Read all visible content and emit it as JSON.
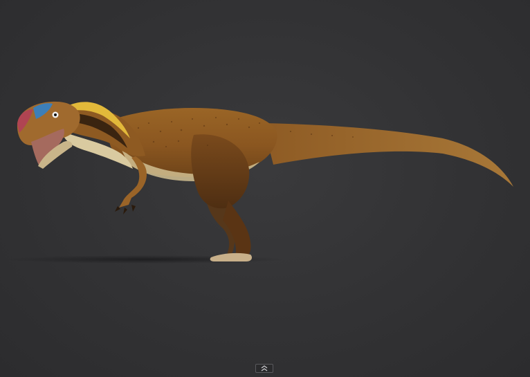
{
  "viewer": {
    "background_color": "#313133",
    "subject": {
      "name": "theropod-dinosaur-illustration",
      "colors": {
        "body": "#8c5a22",
        "belly": "#d6c79a",
        "crest_yellow": "#e2b93a",
        "head_blue": "#3d7fb8",
        "head_red": "#b04452",
        "dark_stripe": "#3a2410"
      }
    },
    "controls": {
      "expand_toggle_icon": "double-chevron-up-icon"
    }
  }
}
